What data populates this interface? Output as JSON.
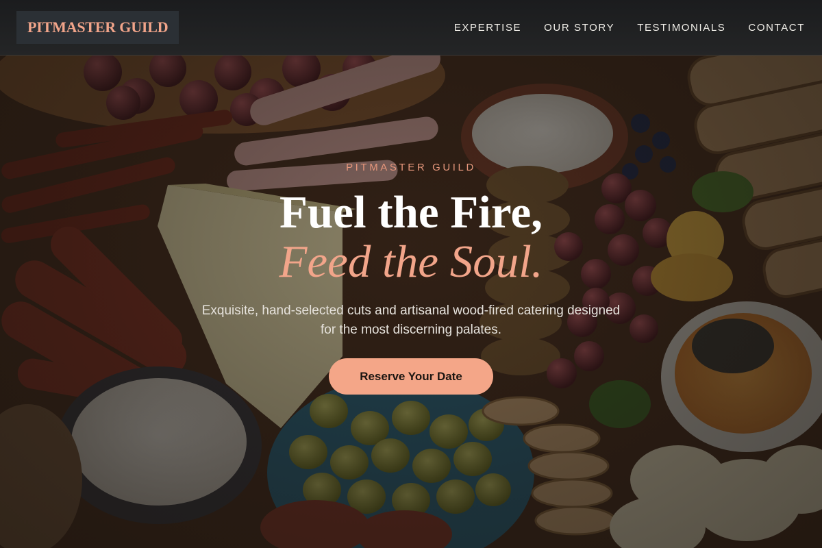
{
  "nav": {
    "brand": "PITMASTER GUILD",
    "links": [
      {
        "label": "EXPERTISE"
      },
      {
        "label": "OUR STORY"
      },
      {
        "label": "TESTIMONIALS"
      },
      {
        "label": "CONTACT"
      }
    ]
  },
  "hero": {
    "eyebrow": "PITMASTER GUILD",
    "headline_line1": "Fuel the Fire,",
    "headline_line2": "Feed the Soul.",
    "subtitle": "Exquisite, hand-selected cuts and artisanal wood-fired catering designed for the most discerning palates.",
    "cta_label": "Reserve Your Date",
    "background_icon": "charcuterie-board-photo"
  },
  "colors": {
    "accent": "#f4a688",
    "brand_text": "#f2a58a",
    "nav_bg": "#222324",
    "text_light": "#ffffff"
  }
}
